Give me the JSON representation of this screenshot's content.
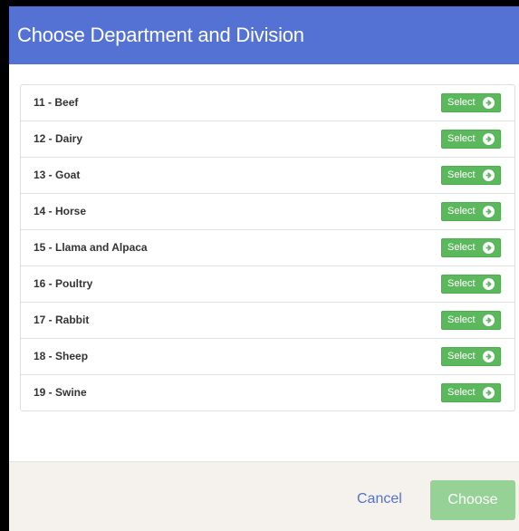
{
  "dialog": {
    "title": "Choose Department and Division"
  },
  "departments": [
    {
      "label": "11 - Beef",
      "button": "Select"
    },
    {
      "label": "12 - Dairy",
      "button": "Select"
    },
    {
      "label": "13 - Goat",
      "button": "Select"
    },
    {
      "label": "14 - Horse",
      "button": "Select"
    },
    {
      "label": "15 - Llama and Alpaca",
      "button": "Select"
    },
    {
      "label": "16 - Poultry",
      "button": "Select"
    },
    {
      "label": "17 - Rabbit",
      "button": "Select"
    },
    {
      "label": "18 - Sheep",
      "button": "Select"
    },
    {
      "label": "19 - Swine",
      "button": "Select"
    }
  ],
  "footer": {
    "cancel_label": "Cancel",
    "choose_label": "Choose"
  },
  "icons": {
    "select_arrow": "circle-arrow-right-icon"
  },
  "colors": {
    "header": "#5472d3",
    "select_button": "#5cb85c",
    "choose_button_disabled": "#96d196",
    "cancel_link": "#5472d3",
    "footer_bg": "#f5f2ee"
  }
}
